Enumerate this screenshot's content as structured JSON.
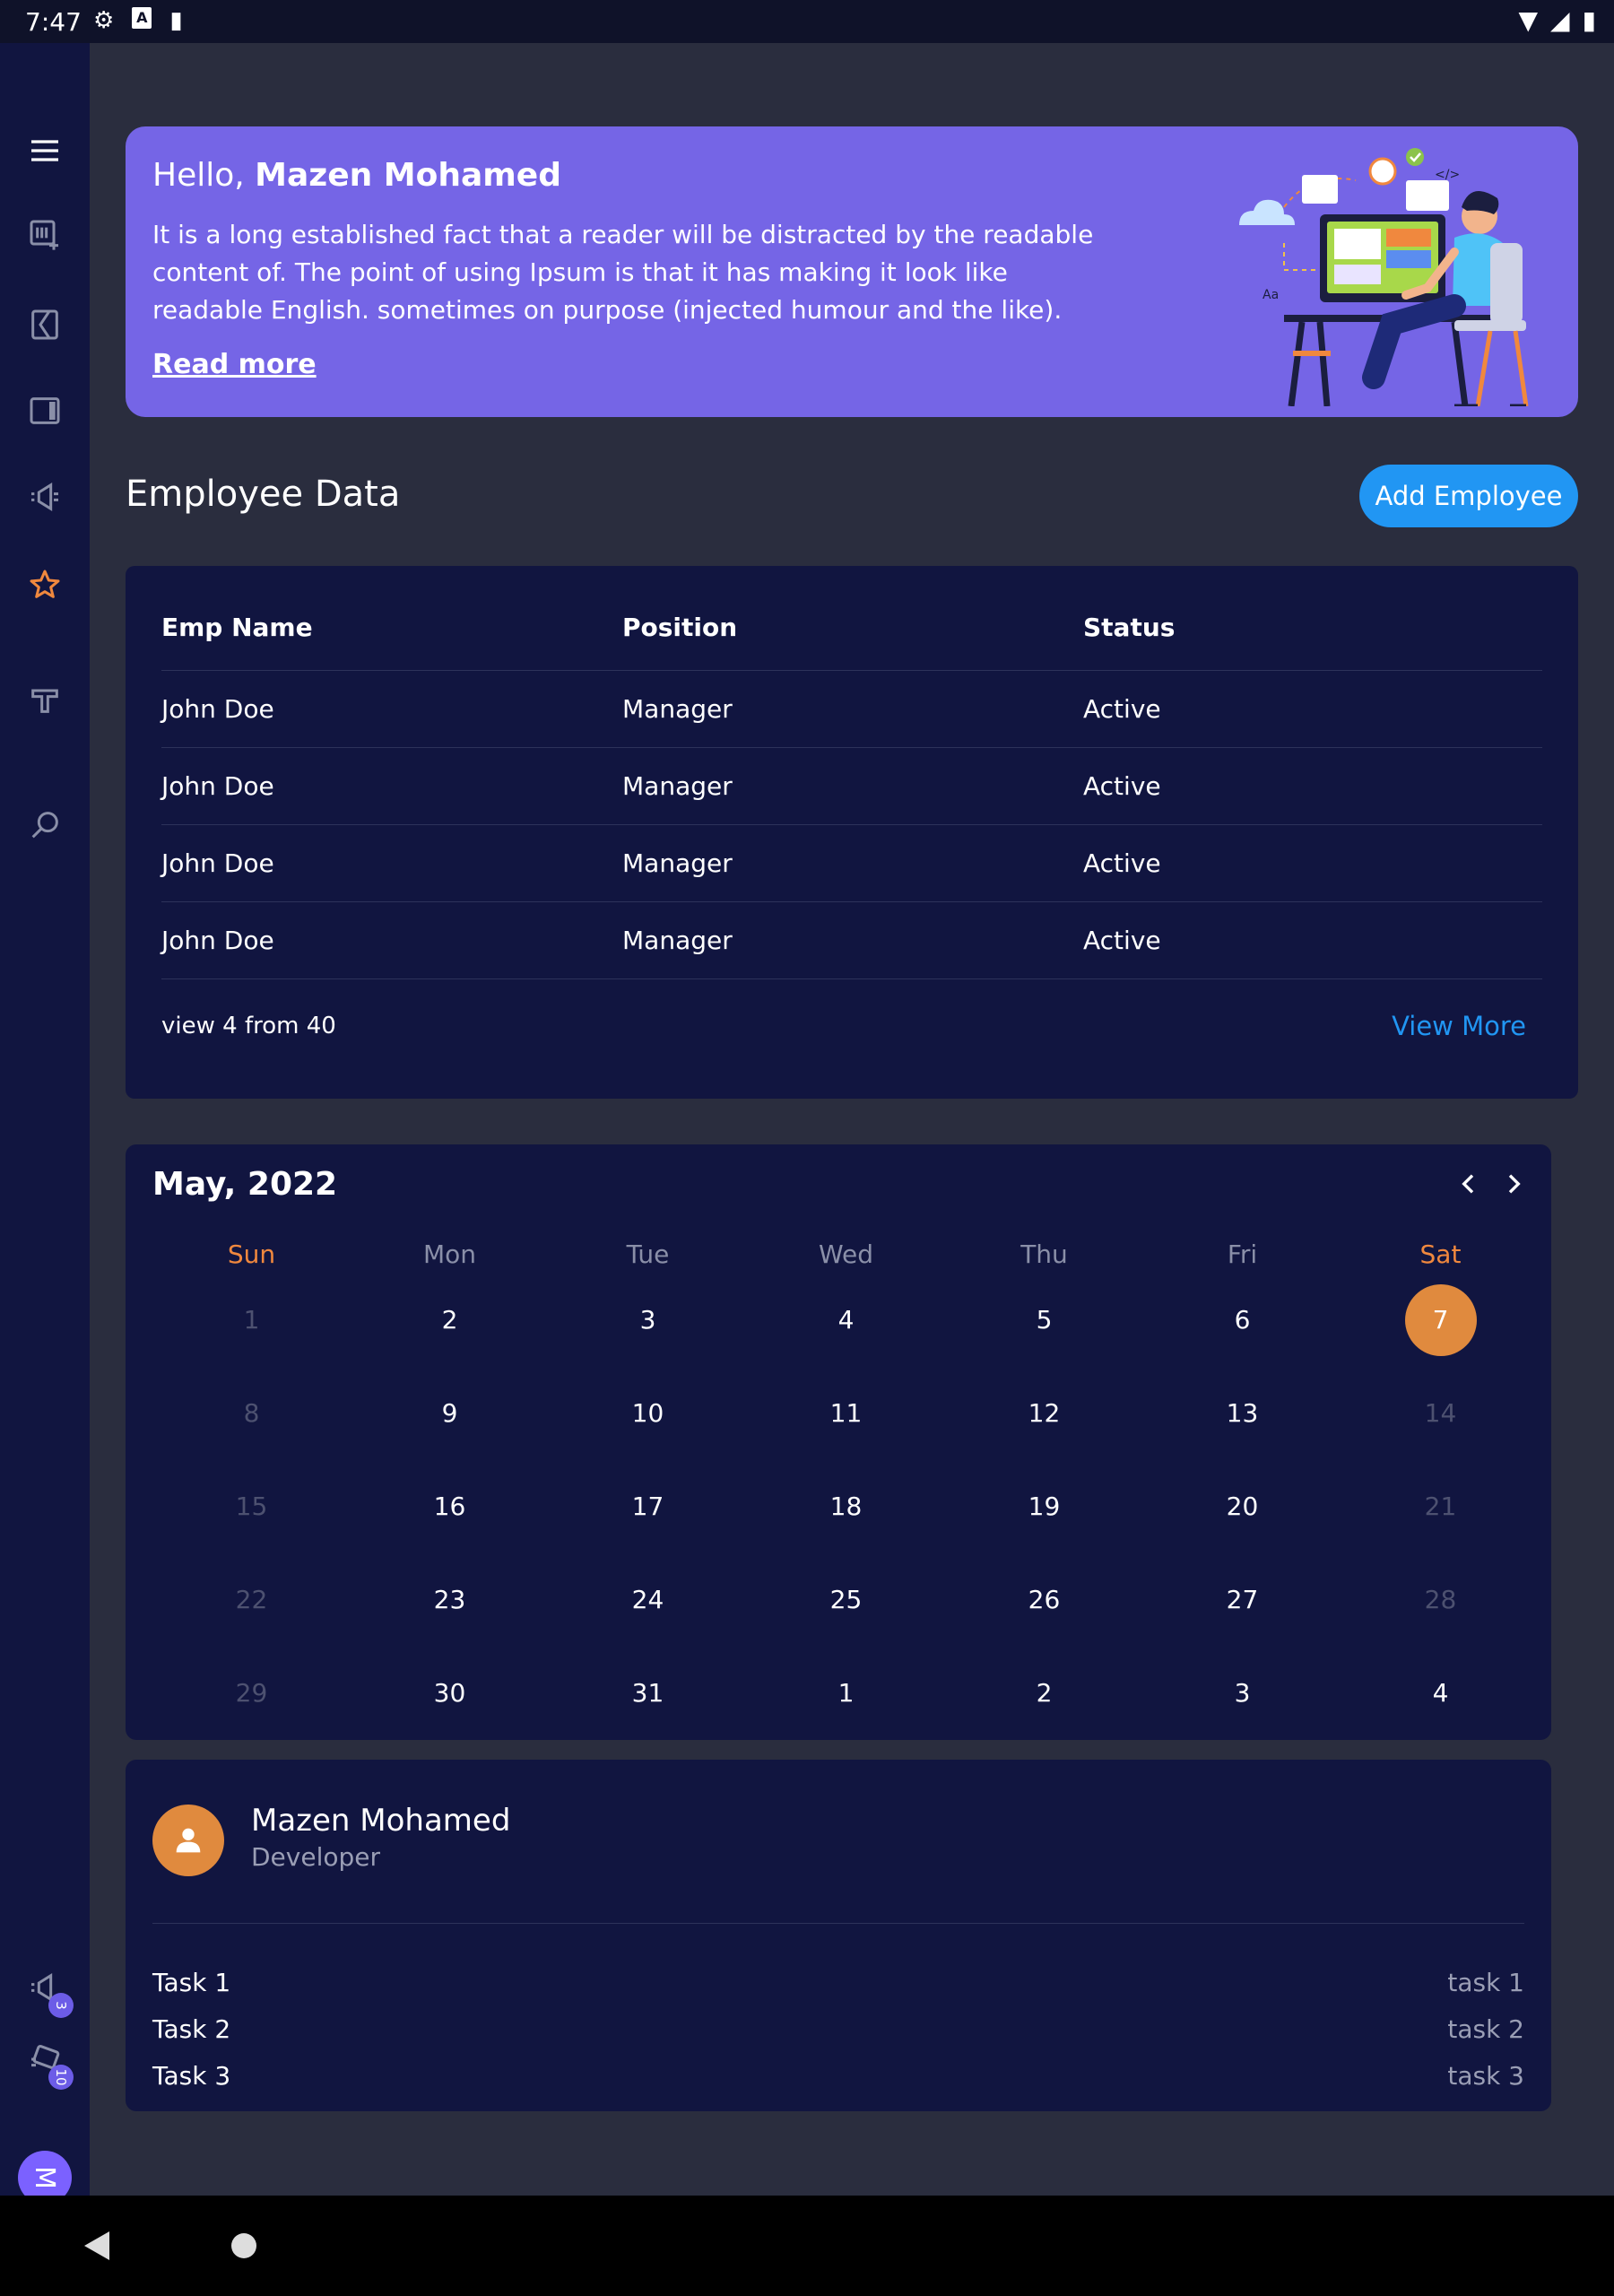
{
  "status_bar": {
    "time": "7:47",
    "icons": [
      "gear-icon",
      "a-box-icon",
      "sd-card-icon"
    ],
    "right_icons": [
      "wifi-icon",
      "signal-icon",
      "battery-icon"
    ]
  },
  "sidebar": {
    "items": [
      {
        "icon": "menu-icon"
      },
      {
        "icon": "playlist-add-icon"
      },
      {
        "icon": "book-icon"
      },
      {
        "icon": "tablet-icon"
      },
      {
        "icon": "campaign-icon"
      },
      {
        "icon": "star-icon",
        "active": true
      },
      {
        "icon": "label-icon"
      },
      {
        "icon": "search-icon"
      }
    ],
    "bottom_items": [
      {
        "icon": "campaign-icon",
        "badge": "3"
      },
      {
        "icon": "devices-icon",
        "badge": "10"
      }
    ],
    "avatar_letter": "M"
  },
  "hero": {
    "greeting": "Hello,",
    "user_name": "Mazen Mohamed",
    "body": "It is a long established fact that a reader will be distracted by the readable content of. The point of using Ipsum is that it has making it look like readable English. sometimes on purpose (injected humour and the like).",
    "read_more": "Read more",
    "illustration_label": "Aa",
    "code_tag": "</>"
  },
  "employees": {
    "title": "Employee Data",
    "add_button": "Add Employee",
    "columns": [
      "Emp Name",
      "Position",
      "Status"
    ],
    "rows": [
      [
        "John Doe",
        "Manager",
        "Active"
      ],
      [
        "John Doe",
        "Manager",
        "Active"
      ],
      [
        "John Doe",
        "Manager",
        "Active"
      ],
      [
        "John Doe",
        "Manager",
        "Active"
      ]
    ],
    "footer_text": "view 4 from 40",
    "view_more": "View More"
  },
  "calendar": {
    "title": "May, 2022",
    "weekdays": [
      "Sun",
      "Mon",
      "Tue",
      "Wed",
      "Thu",
      "Fri",
      "Sat"
    ],
    "weeks": [
      [
        "1",
        "2",
        "3",
        "4",
        "5",
        "6",
        "7"
      ],
      [
        "8",
        "9",
        "10",
        "11",
        "12",
        "13",
        "14"
      ],
      [
        "15",
        "16",
        "17",
        "18",
        "19",
        "20",
        "21"
      ],
      [
        "22",
        "23",
        "24",
        "25",
        "26",
        "27",
        "28"
      ],
      [
        "29",
        "30",
        "31",
        "1",
        "2",
        "3",
        "4"
      ]
    ],
    "dim": [
      [
        true,
        false,
        false,
        false,
        false,
        false,
        false
      ],
      [
        true,
        false,
        false,
        false,
        false,
        false,
        true
      ],
      [
        true,
        false,
        false,
        false,
        false,
        false,
        true
      ],
      [
        true,
        false,
        false,
        false,
        false,
        false,
        true
      ],
      [
        true,
        false,
        false,
        false,
        false,
        false,
        false
      ]
    ],
    "selected": "7",
    "accent_color": "#e08a3e"
  },
  "profile": {
    "name": "Mazen Mohamed",
    "role": "Developer",
    "tasks": [
      {
        "label": "Task 1",
        "value": "task 1"
      },
      {
        "label": "Task 2",
        "value": "task 2"
      },
      {
        "label": "Task 3",
        "value": "task 3"
      }
    ]
  },
  "colors": {
    "background": "#2a2d3e",
    "sidebar": "#111540",
    "card": "#111540",
    "hero": "#7565e6",
    "primary": "#2196f3",
    "accent": "#e08a3e"
  }
}
